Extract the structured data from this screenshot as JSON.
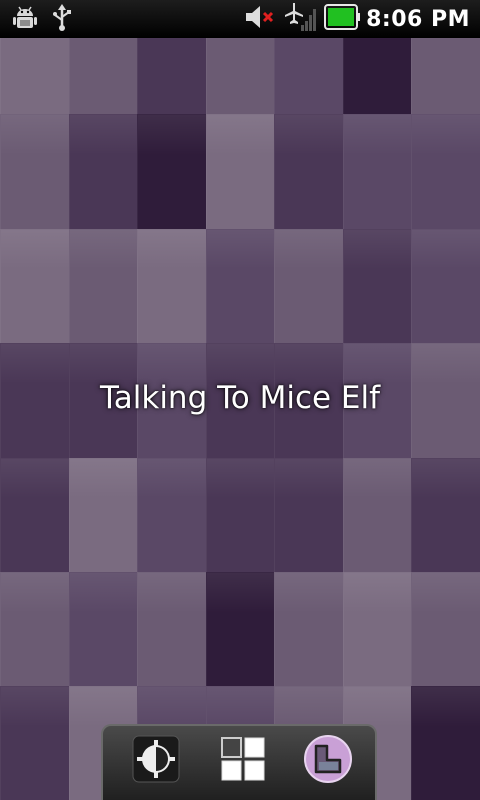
{
  "status_bar": {
    "time": "8:06 PM",
    "icons": [
      "android-debug-icon",
      "usb-icon",
      "volume-muted-icon",
      "airplane-mode-icon",
      "signal-icon",
      "battery-icon"
    ]
  },
  "wallpaper": {
    "title": "Talking To Mice Elf",
    "palette": [
      "#7a6b80",
      "#6b5b73",
      "#5a4866",
      "#4a3756",
      "#2f1c3a",
      "#8a7d8f"
    ]
  },
  "dock": {
    "items": [
      "brightness-icon",
      "grid-icon",
      "launcher-icon"
    ]
  }
}
